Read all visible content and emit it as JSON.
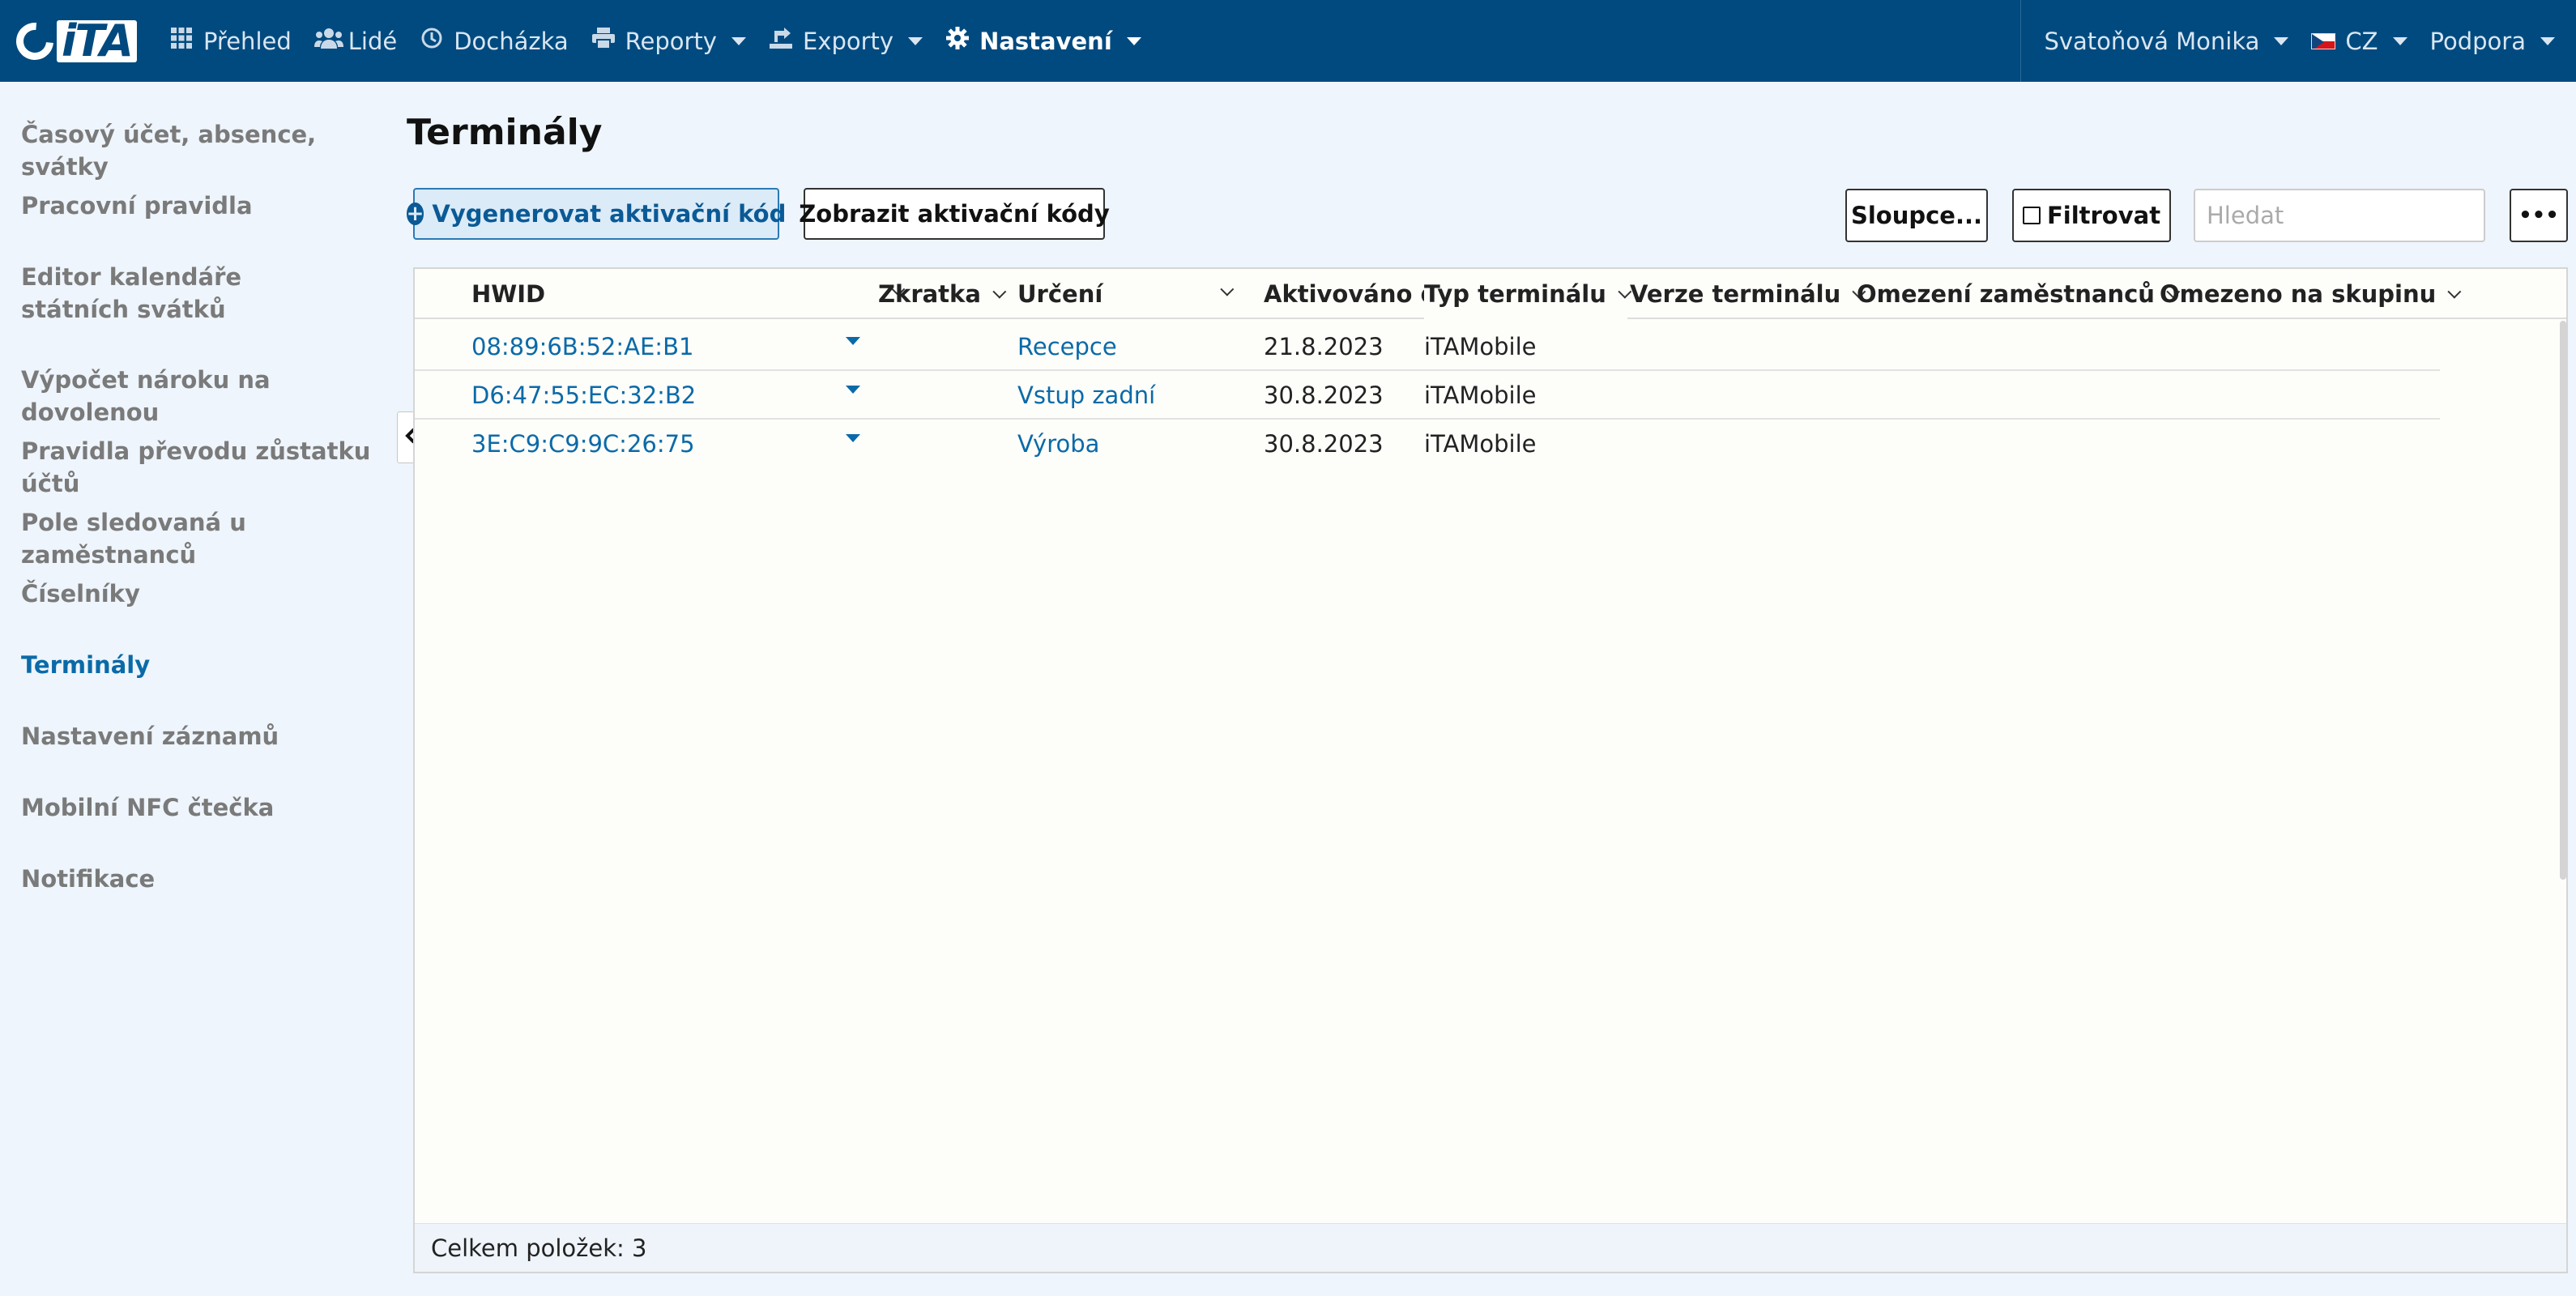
{
  "app": {
    "logo_text": "iTA"
  },
  "nav": {
    "items": [
      {
        "label": "Přehled",
        "icon": "grid-icon"
      },
      {
        "label": "Lidé",
        "icon": "users-icon"
      },
      {
        "label": "Docházka",
        "icon": "clock-icon"
      },
      {
        "label": "Reporty",
        "icon": "print-icon"
      },
      {
        "label": "Exporty",
        "icon": "export-icon"
      },
      {
        "label": "Nastavení",
        "icon": "gear-icon"
      }
    ],
    "user": "Svatoňová Monika",
    "language": "CZ",
    "support": "Podpora"
  },
  "sidebar": {
    "items": [
      {
        "label": "Časový účet, absence, svátky"
      },
      {
        "label": "Pracovní pravidla"
      },
      {
        "label": "Editor kalendáře státních svátků"
      },
      {
        "label": "Výpočet nároku na dovolenou"
      },
      {
        "label": "Pravidla převodu zůstatku účtů"
      },
      {
        "label": "Pole sledovaná u zaměstnanců"
      },
      {
        "label": "Číselníky"
      },
      {
        "label": "Terminály"
      },
      {
        "label": "Nastavení záznamů"
      },
      {
        "label": "Mobilní NFC čtečka"
      },
      {
        "label": "Notifikace"
      }
    ],
    "active_index": 7
  },
  "main": {
    "title": "Terminály",
    "toolbar": {
      "generate_label": "Vygenerovat aktivační kód",
      "show_codes_label": "Zobrazit aktivační kódy",
      "columns_label": "Sloupce...",
      "filter_label": "Filtrovat",
      "search_placeholder": "Hledat",
      "more_label": "•••"
    },
    "grid": {
      "columns": [
        "HWID",
        "Zkratka",
        "Určení",
        "Aktivováno dne",
        "Typ terminálu",
        "Verze terminálu",
        "Omezení zaměstnanců",
        "Omezeno na skupinu"
      ],
      "rows": [
        {
          "hwid": "08:89:6B:52:AE:B1",
          "zkratka": "",
          "urceni": "Recepce",
          "aktivovano": "21.8.2023",
          "typ": "iTAMobile",
          "verze": "",
          "omezeni": "",
          "skupina": ""
        },
        {
          "hwid": "D6:47:55:EC:32:B2",
          "zkratka": "",
          "urceni": "Vstup zadní",
          "aktivovano": "30.8.2023",
          "typ": "iTAMobile",
          "verze": "",
          "omezeni": "",
          "skupina": ""
        },
        {
          "hwid": "3E:C9:C9:9C:26:75",
          "zkratka": "",
          "urceni": "Výroba",
          "aktivovano": "30.8.2023",
          "typ": "iTAMobile",
          "verze": "",
          "omezeni": "",
          "skupina": ""
        }
      ],
      "footer": "Celkem položek: 3"
    }
  },
  "colors": {
    "topbar": "#004a7f",
    "background": "#eef5fc",
    "link": "#0a6aa8",
    "sidebar_inactive": "#7a7a7a"
  }
}
